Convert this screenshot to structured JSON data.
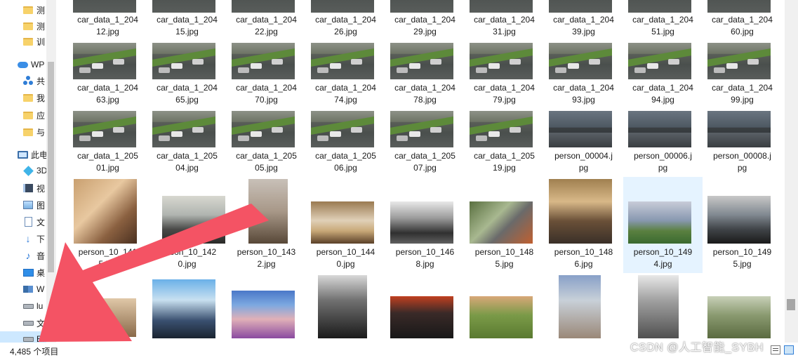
{
  "nav": {
    "items": [
      {
        "icon": "folder-icon",
        "label": "测"
      },
      {
        "icon": "folder-icon",
        "label": "测"
      },
      {
        "icon": "folder-icon",
        "label": "训"
      },
      {
        "icon": "cloud-icon",
        "label": "WP"
      },
      {
        "icon": "share-icon",
        "label": "共"
      },
      {
        "icon": "folder-icon",
        "label": "我"
      },
      {
        "icon": "folder-icon",
        "label": "应"
      },
      {
        "icon": "folder-icon",
        "label": "与"
      },
      {
        "icon": "this-pc-icon",
        "label": "此电"
      },
      {
        "icon": "3d-objects-icon",
        "label": "3D"
      },
      {
        "icon": "video-icon",
        "label": "视"
      },
      {
        "icon": "pictures-icon",
        "label": "图"
      },
      {
        "icon": "documents-icon",
        "label": "文"
      },
      {
        "icon": "downloads-icon",
        "label": "下"
      },
      {
        "icon": "music-icon",
        "label": "音"
      },
      {
        "icon": "desktop-icon",
        "label": "桌"
      },
      {
        "icon": "windows-drive-icon",
        "label": "W"
      },
      {
        "icon": "drive-icon",
        "label": "lu"
      },
      {
        "icon": "drive-icon",
        "label": "文"
      },
      {
        "icon": "drive-icon",
        "label": "EI"
      }
    ]
  },
  "files": {
    "row1": [
      "car_data_1_204\n12.jpg",
      "car_data_1_204\n15.jpg",
      "car_data_1_204\n22.jpg",
      "car_data_1_204\n26.jpg",
      "car_data_1_204\n29.jpg",
      "car_data_1_204\n31.jpg",
      "car_data_1_204\n39.jpg",
      "car_data_1_204\n51.jpg",
      "car_data_1_204\n60.jpg"
    ],
    "row2": [
      "car_data_1_204\n63.jpg",
      "car_data_1_204\n65.jpg",
      "car_data_1_204\n70.jpg",
      "car_data_1_204\n74.jpg",
      "car_data_1_204\n78.jpg",
      "car_data_1_204\n79.jpg",
      "car_data_1_204\n93.jpg",
      "car_data_1_204\n94.jpg",
      "car_data_1_204\n99.jpg"
    ],
    "row3": [
      "car_data_1_205\n01.jpg",
      "car_data_1_205\n04.jpg",
      "car_data_1_205\n05.jpg",
      "car_data_1_205\n06.jpg",
      "car_data_1_205\n07.jpg",
      "car_data_1_205\n19.jpg",
      "person_00004.j\npg",
      "person_00006.j\npg",
      "person_00008.j\npg"
    ],
    "row4": [
      "person_10_141\n5.jpg",
      "person_10_142\n0.jpg",
      "person_10_143\n2.jpg",
      "person_10_144\n0.jpg",
      "person_10_146\n8.jpg",
      "person_10_148\n5.jpg",
      "person_10_148\n6.jpg",
      "person_10_149\n4.jpg",
      "person_10_149\n5.jpg"
    ]
  },
  "status": {
    "item_count": "4,485 个项目"
  },
  "watermark": "CSDN @人工智能_SYBH",
  "colors": {
    "selection": "#e5f3ff",
    "nav_selection": "#cde8ff",
    "arrow": "#f45364"
  }
}
